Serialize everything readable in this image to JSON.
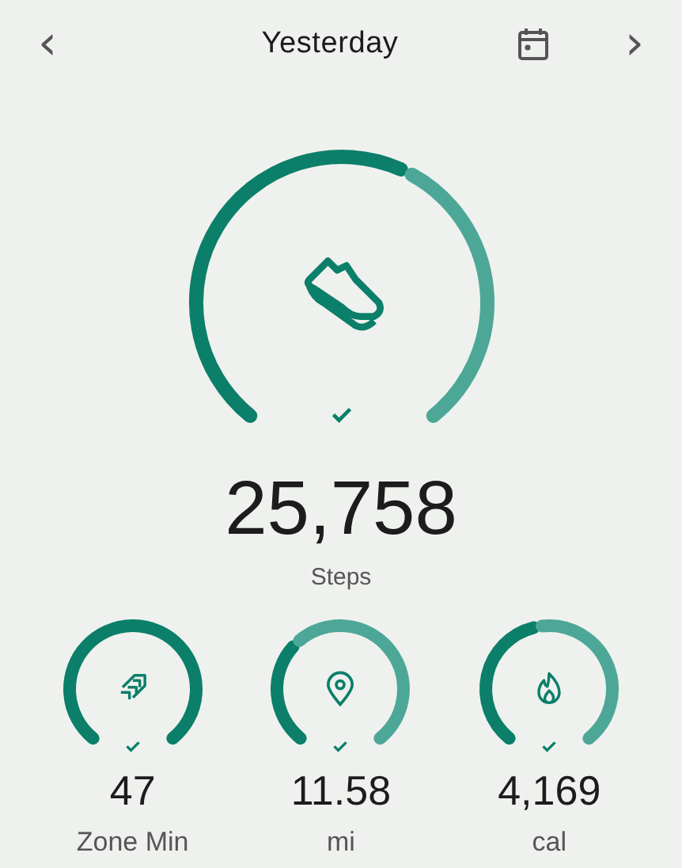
{
  "header": {
    "title": "Yesterday",
    "prev": "‹",
    "next": "›"
  },
  "main": {
    "kind": "steps",
    "value": "25,758",
    "label": "Steps",
    "goal_met": true
  },
  "metrics": [
    {
      "kind": "zone",
      "value": "47",
      "label": "Zone Min",
      "goal_met": true
    },
    {
      "kind": "distance",
      "value": "11.58",
      "label": "mi",
      "goal_met": true
    },
    {
      "kind": "calories",
      "value": "4,169",
      "label": "cal",
      "goal_met": true
    }
  ]
}
